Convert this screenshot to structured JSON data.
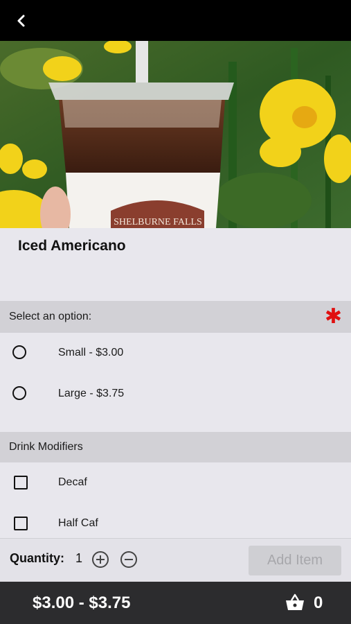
{
  "header": {
    "back_icon": "chevron-left-icon"
  },
  "hero": {
    "sleeve_text": "SHELBURNE FALLS"
  },
  "product": {
    "title": "Iced Americano"
  },
  "options": {
    "label": "Select an option:",
    "required_marker": "✱",
    "required_color": "#e01010",
    "items": [
      {
        "label": "Small - $3.00",
        "selected": false
      },
      {
        "label": "Large - $3.75",
        "selected": false
      }
    ]
  },
  "modifiers": {
    "label": "Drink Modifiers",
    "items": [
      {
        "label": "Decaf",
        "checked": false
      },
      {
        "label": "Half Caf",
        "checked": false
      }
    ]
  },
  "quantity": {
    "label": "Quantity:",
    "value": "1",
    "increase_icon": "plus-circle-icon",
    "decrease_icon": "minus-circle-icon"
  },
  "actions": {
    "add_label": "Add Item"
  },
  "footer": {
    "price_range": "$3.00 - $3.75",
    "cart_icon": "basket-icon",
    "cart_count": "0"
  }
}
